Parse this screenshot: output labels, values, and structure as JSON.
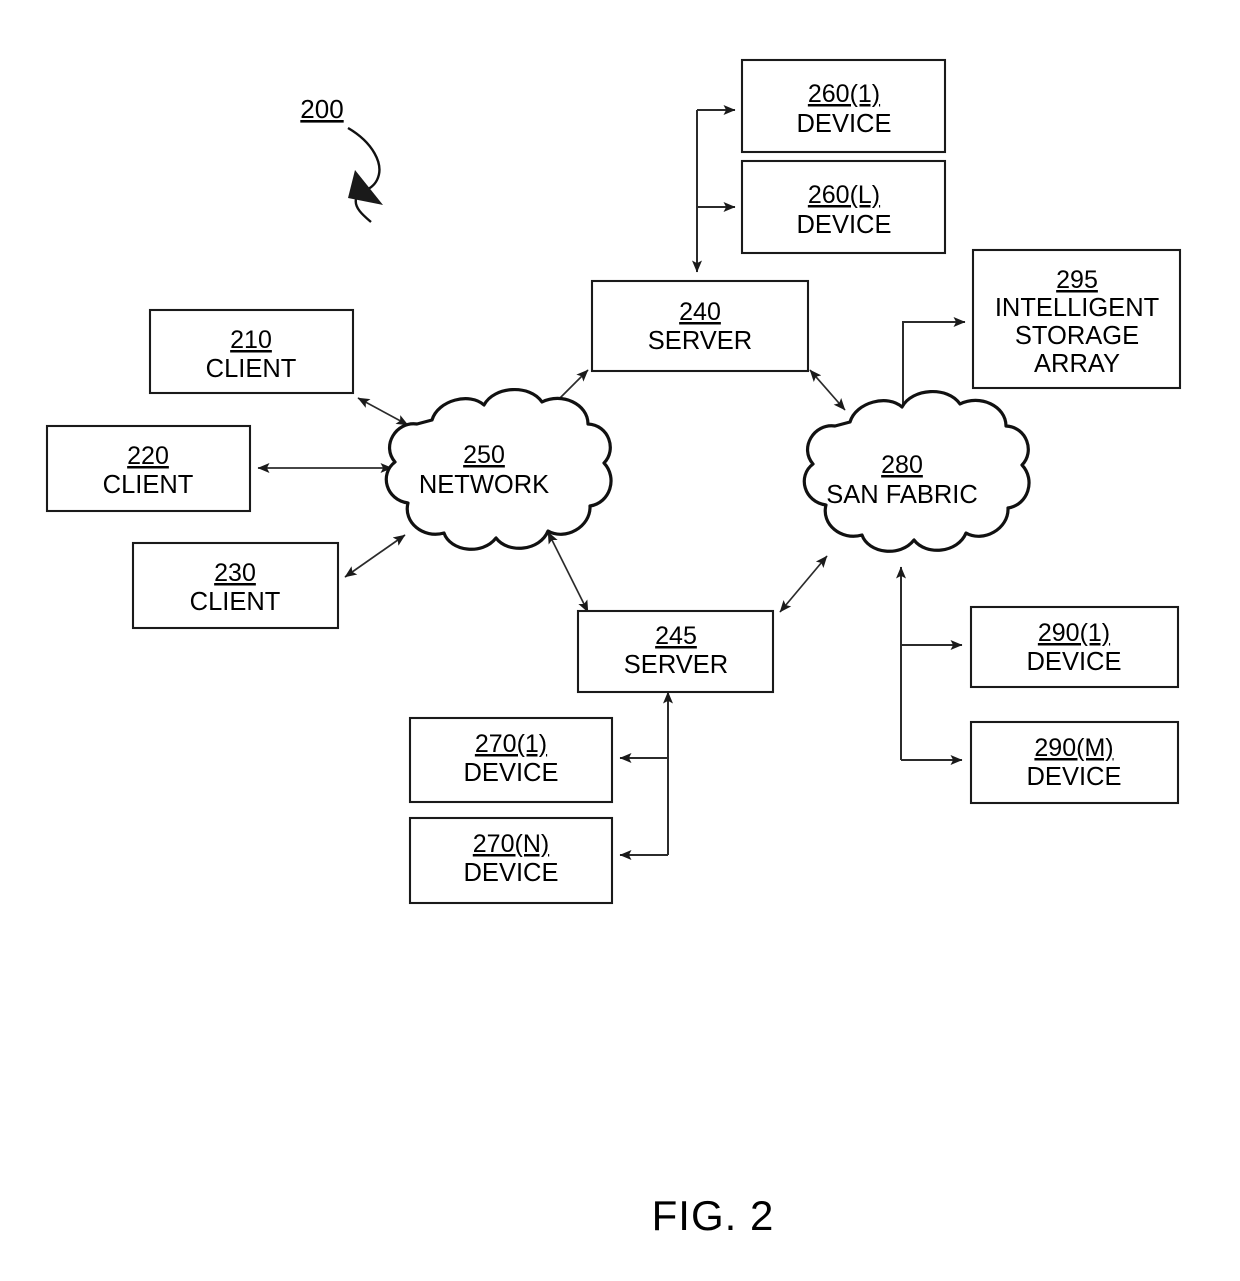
{
  "figure": {
    "caption": "FIG. 2",
    "reference_numeral": "200"
  },
  "nodes": {
    "client_210": {
      "number": "210",
      "name": "CLIENT"
    },
    "client_220": {
      "number": "220",
      "name": "CLIENT"
    },
    "client_230": {
      "number": "230",
      "name": "CLIENT"
    },
    "server_240": {
      "number": "240",
      "name": "SERVER"
    },
    "server_245": {
      "number": "245",
      "name": "SERVER"
    },
    "network_250": {
      "number": "250",
      "name": "NETWORK"
    },
    "device_260_1": {
      "number": "260(1)",
      "name": "DEVICE"
    },
    "device_260_L": {
      "number": "260(L)",
      "name": "DEVICE"
    },
    "device_270_1": {
      "number": "270(1)",
      "name": "DEVICE"
    },
    "device_270_N": {
      "number": "270(N)",
      "name": "DEVICE"
    },
    "san_fabric_280": {
      "number": "280",
      "name": "SAN FABRIC"
    },
    "device_290_1": {
      "number": "290(1)",
      "name": "DEVICE"
    },
    "device_290_M": {
      "number": "290(M)",
      "name": "DEVICE"
    },
    "storage_array_295": {
      "number": "295",
      "name_line1": "INTELLIGENT",
      "name_line2": "STORAGE",
      "name_line3": "ARRAY"
    }
  },
  "colors": {
    "ink": "#000000",
    "line": "#2b2b2b",
    "background": "#ffffff"
  }
}
